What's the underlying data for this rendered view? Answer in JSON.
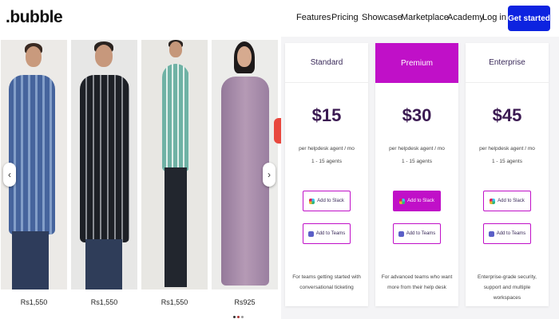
{
  "nav": {
    "logo": ".bubble",
    "links": [
      "Features",
      "Pricing",
      "Showcase",
      "Marketplace",
      "Academy",
      "Log in"
    ],
    "cta": "Get started"
  },
  "gallery": {
    "products": [
      {
        "price": "Rs1,550",
        "shirt": "#8fa9cf"
      },
      {
        "price": "Rs1,550",
        "shirt": "#2a2d33"
      },
      {
        "price": "Rs1,550",
        "shirt": "#8cc4b8"
      },
      {
        "price": "Rs925",
        "shirt": "#a48aa3"
      }
    ],
    "prev_icon": "‹",
    "next_icon": "›"
  },
  "plans": [
    {
      "name": "Standard",
      "price": "$15",
      "desc_line1": "per helpdesk agent / mo",
      "desc_line2": "1 - 15 agents",
      "slack_label": "Add to Slack",
      "teams_label": "Add to Teams",
      "footer": "For teams getting started with conversational ticketing"
    },
    {
      "name": "Premium",
      "price": "$30",
      "desc_line1": "per helpdesk agent / mo",
      "desc_line2": "1 - 15 agents",
      "slack_label": "Add to Slack",
      "teams_label": "Add to Teams",
      "footer": "For advanced teams who want more from their help desk"
    },
    {
      "name": "Enterprise",
      "price": "$45",
      "desc_line1": "per helpdesk agent / mo",
      "desc_line2": "1 - 15 agents",
      "slack_label": "Add to Slack",
      "teams_label": "Add to Teams",
      "footer": "Enterprise-grade security, support and multiple workspaces"
    }
  ],
  "colors": {
    "cta_blue": "#0d23e0",
    "premium_magenta": "#c010c8",
    "price_purple": "#3b1a52"
  },
  "icons": [
    "slack-icon",
    "teams-icon",
    "chevron-left-icon",
    "chevron-right-icon"
  ]
}
